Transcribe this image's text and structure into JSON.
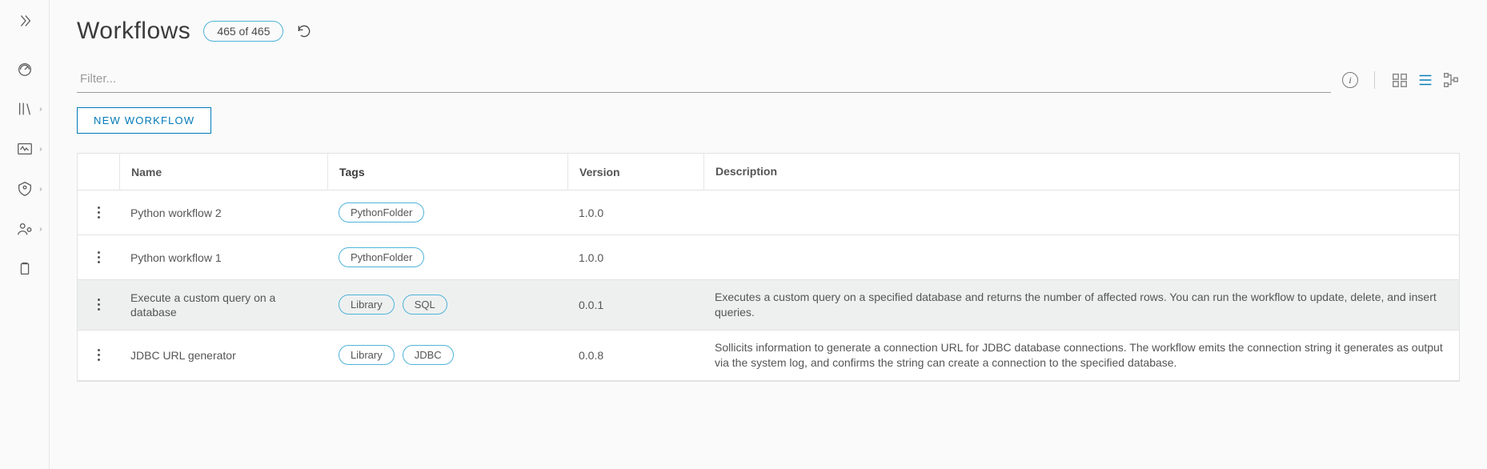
{
  "header": {
    "title": "Workflows",
    "count_badge": "465 of 465"
  },
  "filter": {
    "placeholder": "Filter..."
  },
  "buttons": {
    "new_workflow": "NEW WORKFLOW"
  },
  "columns": {
    "name": "Name",
    "tags": "Tags",
    "version": "Version",
    "description": "Description"
  },
  "rows": [
    {
      "name": "Python workflow 2",
      "tags": [
        "PythonFolder"
      ],
      "version": "1.0.0",
      "description": "",
      "selected": false
    },
    {
      "name": "Python workflow 1",
      "tags": [
        "PythonFolder"
      ],
      "version": "1.0.0",
      "description": "",
      "selected": false
    },
    {
      "name": "Execute a custom query on a database",
      "tags": [
        "Library",
        "SQL"
      ],
      "version": "0.0.1",
      "description": "Executes a custom query on a specified database and returns the number of affected rows. You can run the workflow to update, delete, and insert queries.",
      "selected": true
    },
    {
      "name": "JDBC URL generator",
      "tags": [
        "Library",
        "JDBC"
      ],
      "version": "0.0.8",
      "description": "Sollicits information to generate a connection URL for JDBC database connections. The workflow emits the connection string it generates as output via the system log, and confirms the string can create a connection to the specified database.",
      "selected": false
    }
  ]
}
